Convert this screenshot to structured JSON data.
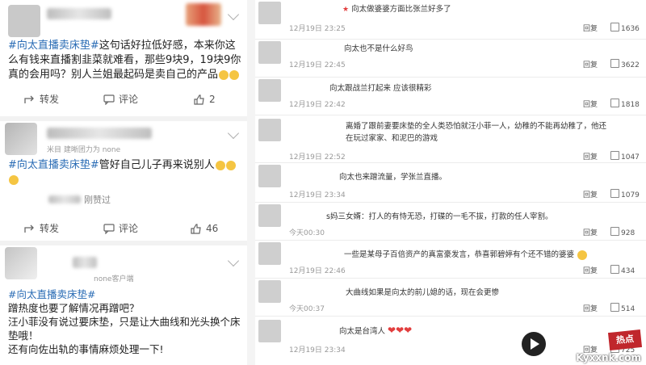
{
  "left_posts": [
    {
      "hashtag": "#向太直播卖床垫#",
      "body": "这句话好拉低好感，本来你这么有钱来直播割韭菜就难看，那些9块9，19块9你真的会用吗？别人兰姐最起码是卖自己的产品",
      "actions": {
        "repost": "转发",
        "comment": "评论",
        "likes": "2"
      }
    },
    {
      "meta": "米目 建晰团力为 none",
      "hashtag": "#向太直播卖床垫#",
      "body": "管好自己儿子再来说别人",
      "sub": "刚赞过",
      "actions": {
        "repost": "转发",
        "comment": "评论",
        "likes": "46"
      }
    },
    {
      "meta": "none客户端",
      "hashtag": "#向太直播卖床垫#",
      "lines": [
        "蹭热度也要了解情况再蹭吧？",
        "汪小菲没有说过要床垫，只是让大曲线和光头换个床垫哦！",
        "还有向佐出轨的事情麻烦处理一下!"
      ]
    }
  ],
  "comments": [
    {
      "text": "向太做婆婆方面比张兰好多了",
      "time": "12月19日 23:25",
      "reply": "回复",
      "likes": "1636"
    },
    {
      "text": "向太也不是什么好鸟",
      "time": "12月19日 22:45",
      "reply": "回复",
      "likes": "3622"
    },
    {
      "text": "向太跟战兰打起来 应该很精彩",
      "time": "12月19日 22:42",
      "reply": "回复",
      "likes": "1818"
    },
    {
      "text": "离婚了跟前妻要床垫的全人类恐怕就汪小菲一人，幼稚的不能再幼稚了，他还在玩过家家、和泥巴的游戏",
      "time": "12月19日 22:52",
      "reply": "回复",
      "likes": "1047"
    },
    {
      "text": "向太也来蹭流量，学张兰直播。",
      "time": "12月19日 23:34",
      "reply": "回复",
      "likes": "1079"
    },
    {
      "text": "s妈三女婿：打人的有恃无恐，打碟的一毛不拔，打款的任人宰割。",
      "time": "今天00:30",
      "reply": "回复",
      "likes": "928"
    },
    {
      "text": "一些是某母子百倍资产的真富豪发言，恭喜郭碧婷有个还不错的婆婆",
      "time": "12月19日 22:46",
      "reply": "回复",
      "likes": "434"
    },
    {
      "text": "大曲线如果是向太的前儿媳的话，现在会更惨",
      "time": "今天00:37",
      "reply": "回复",
      "likes": "514"
    },
    {
      "text": "向太是台湾人",
      "time": "12月19日 23:34",
      "reply": "回复",
      "likes": "725"
    }
  ],
  "watermark": "Kyxxnk.com",
  "watermark_badge": "热点"
}
